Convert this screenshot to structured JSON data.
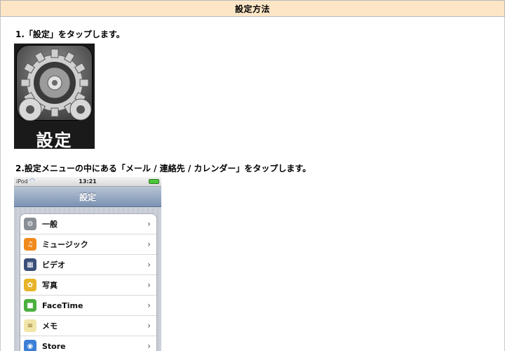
{
  "header": {
    "title": "設定方法"
  },
  "steps": [
    {
      "text": "1.「設定」をタップします。"
    },
    {
      "text": "2.設定メニューの中にある「メール / 連絡先 / カレンダー」をタップします。"
    }
  ],
  "app_icon": {
    "caption": "設定",
    "icon": "gear-icon"
  },
  "ipod": {
    "status": {
      "carrier": "iPod",
      "time": "13:21"
    },
    "nav_title": "設定",
    "items": [
      {
        "label": "一般",
        "icon": "general-icon",
        "color": "#8a8f96"
      },
      {
        "label": "ミュージック",
        "icon": "music-icon",
        "color": "#f08a1c"
      },
      {
        "label": "ビデオ",
        "icon": "video-icon",
        "color": "#3a4f7a"
      },
      {
        "label": "写真",
        "icon": "photos-icon",
        "color": "#e8b52a"
      },
      {
        "label": "FaceTime",
        "icon": "facetime-icon",
        "color": "#4caf3f"
      },
      {
        "label": "メモ",
        "icon": "notes-icon",
        "color": "#f1e5a8"
      },
      {
        "label": "Store",
        "icon": "store-icon",
        "color": "#3c7fd6"
      }
    ]
  }
}
